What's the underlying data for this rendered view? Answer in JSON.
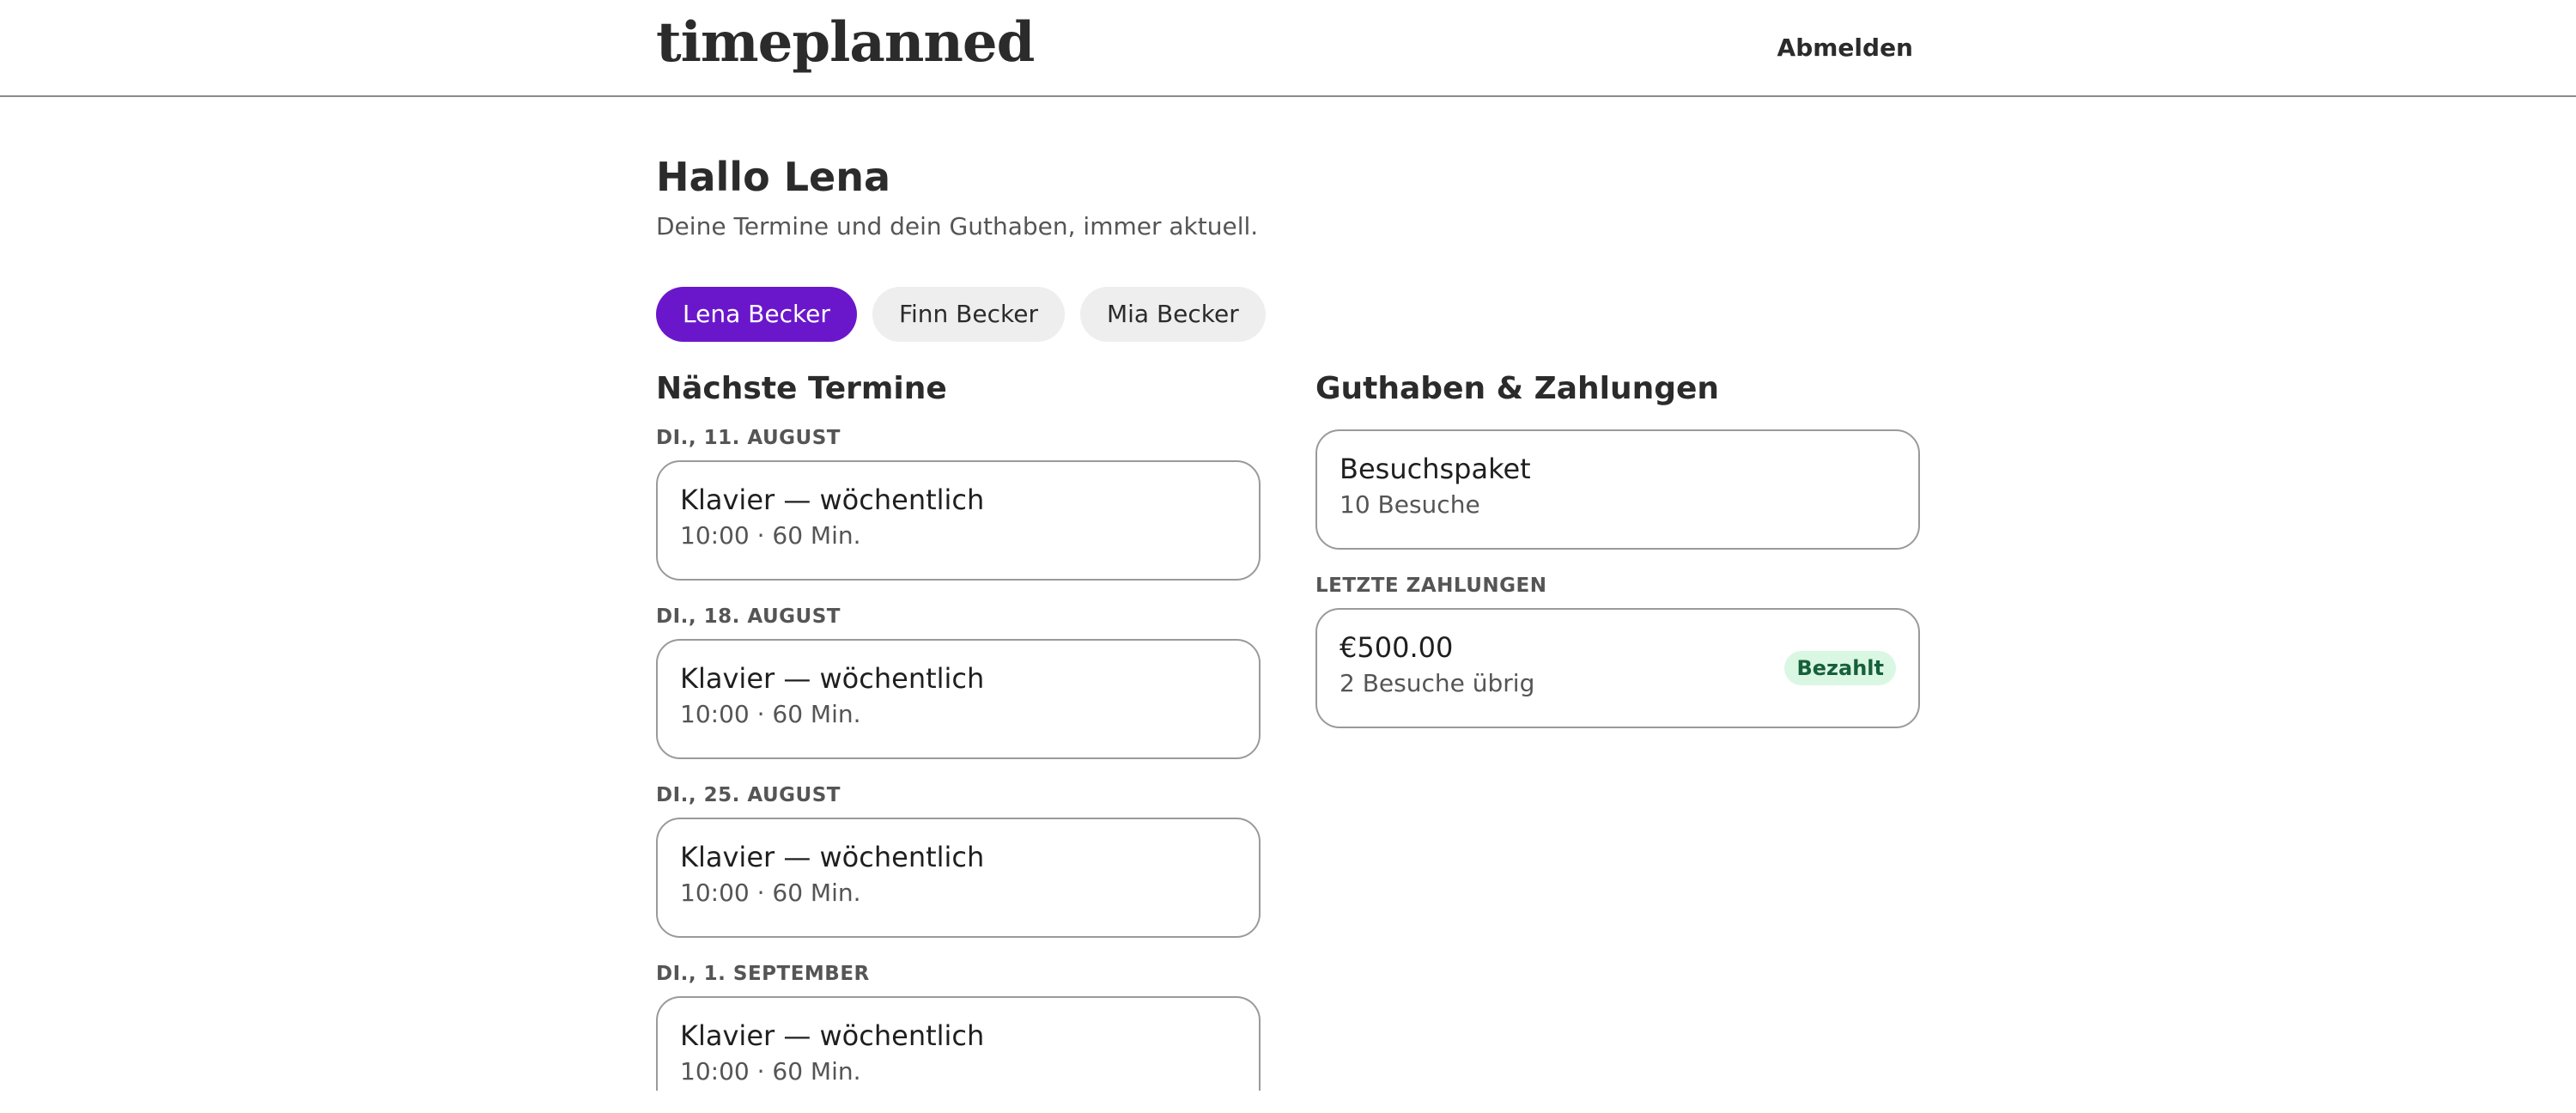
{
  "header": {
    "logo": "timeplanned",
    "logout_label": "Abmelden"
  },
  "greeting": {
    "title": "Hallo Lena",
    "subtitle": "Deine Termine und dein Guthaben, immer aktuell."
  },
  "people": [
    {
      "name": "Lena Becker",
      "active": true
    },
    {
      "name": "Finn Becker",
      "active": false
    },
    {
      "name": "Mia Becker",
      "active": false
    }
  ],
  "appointments": {
    "title": "Nächste Termine",
    "groups": [
      {
        "date": "DI., 11. AUGUST",
        "title": "Klavier — wöchentlich",
        "detail": "10:00 · 60 Min."
      },
      {
        "date": "DI., 18. AUGUST",
        "title": "Klavier — wöchentlich",
        "detail": "10:00 · 60 Min."
      },
      {
        "date": "DI., 25. AUGUST",
        "title": "Klavier — wöchentlich",
        "detail": "10:00 · 60 Min."
      },
      {
        "date": "DI., 1. SEPTEMBER",
        "title": "Klavier — wöchentlich",
        "detail": "10:00 · 60 Min."
      }
    ]
  },
  "balance": {
    "title": "Guthaben & Zahlungen",
    "package": {
      "title": "Besuchspaket",
      "detail": "10 Besuche"
    },
    "payments_label": "LETZTE ZAHLUNGEN",
    "payments": [
      {
        "amount": "€500.00",
        "detail": "2 Besuche übrig",
        "status": "Bezahlt"
      }
    ]
  },
  "colors": {
    "accent": "#6a17cc",
    "badge_bg": "#daf7e4",
    "badge_text": "#16603a"
  }
}
